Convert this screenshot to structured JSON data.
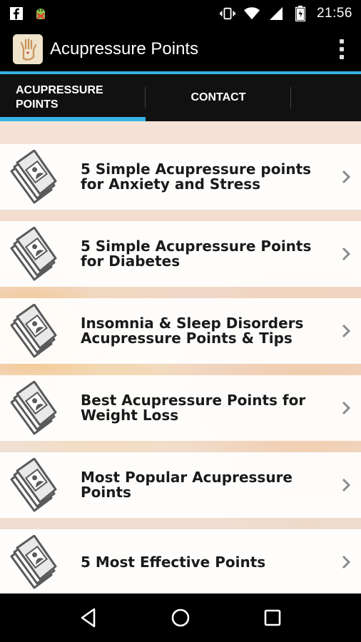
{
  "status_bar": {
    "time": "21:56",
    "left_icons": [
      "facebook-icon",
      "android-debug-icon"
    ],
    "right_icons": [
      "vibrate-icon",
      "wifi-icon",
      "signal-icon",
      "battery-icon"
    ]
  },
  "action_bar": {
    "title": "Acupressure Points",
    "accent_color": "#35b3e5"
  },
  "tabs": [
    {
      "label": "ACUPRESSURE POINTS",
      "selected": true
    },
    {
      "label": "CONTACT",
      "selected": false
    }
  ],
  "list": {
    "items": [
      {
        "label": "5 Simple Acupressure points for Anxiety and Stress",
        "icon": "document-stack-icon"
      },
      {
        "label": "5 Simple Acupressure Points for Diabetes",
        "icon": "document-stack-icon"
      },
      {
        "label": "Insomnia & Sleep Disorders Acupressure Points & Tips",
        "icon": "document-stack-icon"
      },
      {
        "label": "Best Acupressure Points for Weight Loss",
        "icon": "document-stack-icon"
      },
      {
        "label": "Most Popular Acupressure Points",
        "icon": "document-stack-icon"
      },
      {
        "label": "5 Most Effective Points",
        "icon": "document-stack-icon"
      }
    ]
  },
  "nav_bar": {
    "buttons": [
      "back-icon",
      "home-icon",
      "recents-icon"
    ]
  }
}
